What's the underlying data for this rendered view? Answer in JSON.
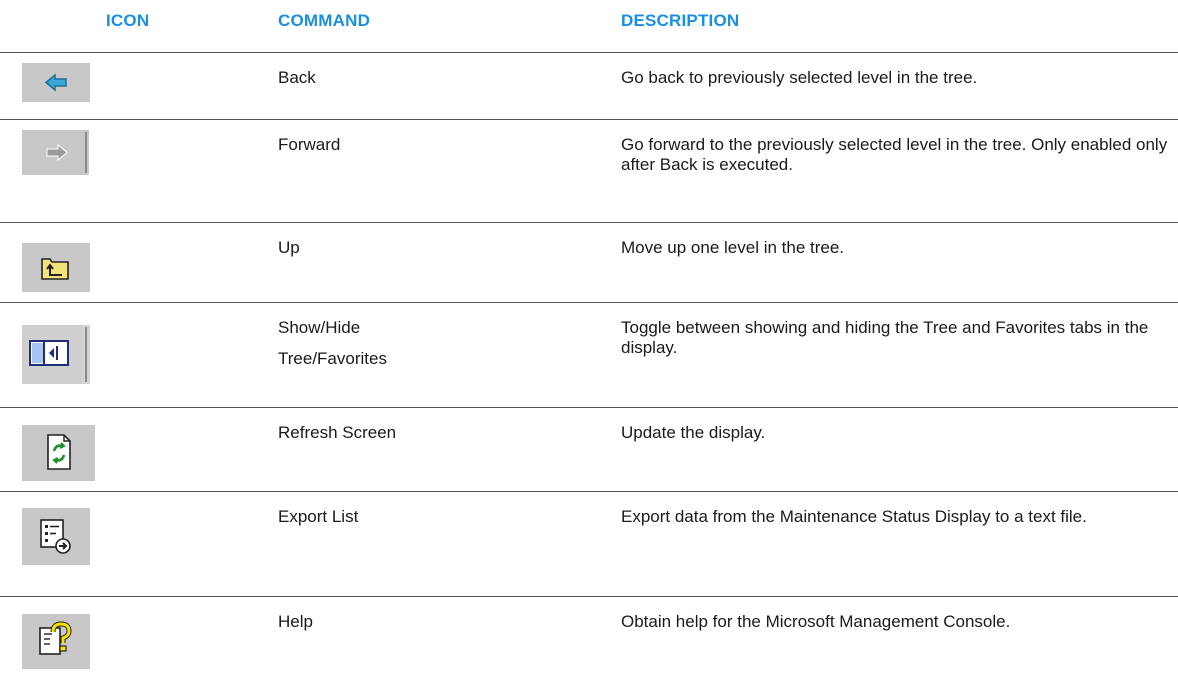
{
  "headers": {
    "icon": "ICON",
    "command": "COMMAND",
    "description": "DESCRIPTION"
  },
  "rows": [
    {
      "icon": "back-arrow-icon",
      "command": "Back",
      "command_line2": "",
      "description": "Go back to previously selected level in the tree."
    },
    {
      "icon": "forward-arrow-icon",
      "command": "Forward",
      "command_line2": "",
      "description": "Go forward to the previously selected level in the tree. Only enabled only after Back is executed."
    },
    {
      "icon": "up-folder-icon",
      "command": "Up",
      "command_line2": "",
      "description": "Move up one level in the tree."
    },
    {
      "icon": "show-hide-tree-icon",
      "command": "Show/Hide",
      "command_line2": "Tree/Favorites",
      "description": "Toggle between showing and hiding the Tree and Favorites tabs in the display."
    },
    {
      "icon": "refresh-icon",
      "command": "Refresh Screen",
      "command_line2": "",
      "description": "Update the display."
    },
    {
      "icon": "export-list-icon",
      "command": "Export List",
      "command_line2": "",
      "description": "Export data from the Maintenance Status Display to a text file."
    },
    {
      "icon": "help-icon",
      "command": "Help",
      "command_line2": "",
      "description": "Obtain help for the Microsoft Management Console."
    }
  ],
  "colors": {
    "header": "#1a8fe0",
    "rule": "#555555",
    "icon_tile": "#c8c8c8"
  }
}
